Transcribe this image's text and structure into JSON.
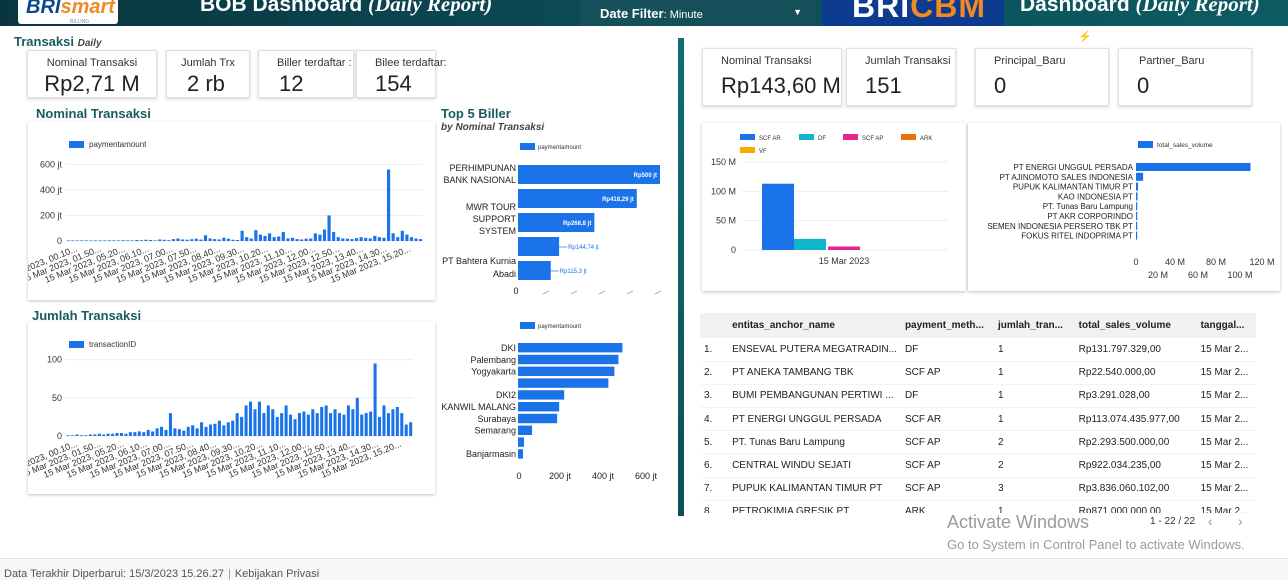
{
  "header": {
    "logo_main": "BRI",
    "logo_accent": "smart",
    "logo_sub": "BILLING",
    "title_left": "BOB Dashboard",
    "title_left_italic": "(Daily Report)",
    "date_filter_label": "Date Filter",
    "date_filter_value": ": Minute",
    "cbm_main": "BRI",
    "cbm_accent": "CBM",
    "title_right": "Dashboard",
    "title_right_italic": "(Daily Report)"
  },
  "transaksi": {
    "title": "Transaksi",
    "subtitle": "Daily",
    "cards": [
      {
        "label": "Nominal Transaksi",
        "value": "Rp2,71 M"
      },
      {
        "label": "Jumlah Trx",
        "value": "2 rb"
      },
      {
        "label": "Biller terdaftar :",
        "value": "12"
      },
      {
        "label": "Bilee terdaftar:",
        "value": "154"
      }
    ]
  },
  "right_cards": [
    {
      "label": "Nominal Transaksi",
      "value": "Rp143,60 M"
    },
    {
      "label": "Jumlah Transaksi",
      "value": "151"
    },
    {
      "label": "Principal_Baru",
      "value": "0"
    },
    {
      "label": "Partner_Baru",
      "value": "0"
    }
  ],
  "sections": {
    "nominal_title": "Nominal Transaksi",
    "jumlah_title": "Jumlah Transaksi",
    "top5_title": "Top 5 Biller",
    "top5_sub": "by  Nominal Transaksi"
  },
  "chart_data": [
    {
      "type": "bar",
      "name": "Nominal Transaksi",
      "legend": "paymentamount",
      "ylabel": "",
      "yticks": [
        "0",
        "200 jt",
        "400 jt",
        "600 jt"
      ],
      "ylim": [
        0,
        650
      ],
      "unit": "jt",
      "x_tick_labels": [
        "2023, 00.10...",
        "15 Mar 2023, 01.50...",
        "15 Mar 2023, 05.20...",
        "15 Mar 2023, 06.10...",
        "15 Mar 2023, 07.00...",
        "15 Mar 2023, 07.50...",
        "15 Mar 2023, 08.40...",
        "15 Mar 2023, 09.30...",
        "15 Mar 2023, 10.20...",
        "15 Mar 2023, 11.10...",
        "15 Mar 2023, 12.00...",
        "15 Mar 2023, 12.50...",
        "15 Mar 2023, 13.40...",
        "15 Mar 2023, 14.30...",
        "15 Mar 2023, 15.20..."
      ],
      "values": [
        2,
        1,
        2,
        3,
        1,
        2,
        4,
        3,
        2,
        5,
        4,
        3,
        6,
        5,
        4,
        8,
        6,
        10,
        8,
        5,
        12,
        9,
        7,
        15,
        20,
        12,
        10,
        14,
        18,
        11,
        45,
        20,
        15,
        12,
        25,
        18,
        10,
        8,
        80,
        30,
        20,
        85,
        50,
        40,
        60,
        30,
        35,
        70,
        20,
        25,
        15,
        12,
        18,
        20,
        60,
        50,
        90,
        200,
        70,
        30,
        20,
        18,
        15,
        22,
        30,
        25,
        20,
        40,
        30,
        25,
        560,
        60,
        30,
        80,
        50,
        30,
        20,
        15
      ]
    },
    {
      "type": "bar",
      "name": "Jumlah Transaksi",
      "legend": "transactionID",
      "yticks": [
        "0",
        "50",
        "100"
      ],
      "ylim": [
        0,
        110
      ],
      "x_tick_labels": [
        "2023, 00.10...",
        "15 Mar 2023, 01.50...",
        "15 Mar 2023, 05.20...",
        "15 Mar 2023, 06.10...",
        "15 Mar 2023, 07.00...",
        "15 Mar 2023, 07.50...",
        "15 Mar 2023, 08.40...",
        "15 Mar 2023, 09.30...",
        "15 Mar 2023, 10.20...",
        "15 Mar 2023, 11.10...",
        "15 Mar 2023, 12.00...",
        "15 Mar 2023, 12.50...",
        "15 Mar 2023, 13.40...",
        "15 Mar 2023, 14.30...",
        "15 Mar 2023, 15.20..."
      ],
      "values": [
        1,
        1,
        2,
        1,
        1,
        2,
        2,
        3,
        2,
        3,
        3,
        4,
        4,
        3,
        5,
        5,
        6,
        5,
        8,
        6,
        10,
        12,
        8,
        30,
        10,
        9,
        7,
        12,
        14,
        10,
        18,
        12,
        15,
        16,
        20,
        14,
        18,
        20,
        30,
        25,
        40,
        45,
        35,
        45,
        30,
        40,
        35,
        25,
        30,
        40,
        28,
        22,
        30,
        32,
        28,
        35,
        30,
        38,
        40,
        30,
        35,
        30,
        28,
        40,
        35,
        50,
        28,
        30,
        32,
        95,
        25,
        40,
        30,
        35,
        38,
        30,
        15,
        18
      ]
    },
    {
      "type": "bar",
      "orientation": "horizontal",
      "name": "Top 5 Biller",
      "legend": "paymentamount",
      "categories": [
        "PERHIMPUNAN BANK NASIONAL",
        "",
        "MWR TOUR SUPPORT SYSTEM",
        "",
        "PT Bahtera Kurnia Abadi"
      ],
      "category_lines": [
        [
          "PERHIMPUNAN",
          "BANK NASIONAL"
        ],
        [],
        [
          "MWR TOUR",
          "SUPPORT",
          "SYSTEM"
        ],
        [],
        [
          "PT Bahtera Kurnia",
          "Abadi"
        ]
      ],
      "values": [
        500,
        418.29,
        268.8,
        144.74,
        115.3
      ],
      "value_labels": [
        "Rp500 jt",
        "Rp418,29 jt",
        "Rp268,8 jt",
        "Rp144,74 jt",
        "Rp115,3 jt"
      ]
    },
    {
      "type": "bar",
      "orientation": "horizontal",
      "name": "Regional",
      "legend": "paymentamount",
      "categories": [
        "DKI",
        "Palembang",
        "Yogyakarta",
        "",
        "DKI2",
        "KANWIL MALANG",
        "Surabaya",
        "Semarang",
        "",
        "Banjarmasin"
      ],
      "values": [
        520,
        500,
        480,
        450,
        230,
        205,
        195,
        70,
        30,
        25
      ],
      "xticks": [
        "0",
        "200 jt",
        "400 jt",
        "600 jt"
      ],
      "xlim": [
        0,
        650
      ]
    },
    {
      "type": "bar",
      "name": "Daily by payment method",
      "legend": [
        "SCF AR",
        "DF",
        "SCF AP",
        "ARK",
        "VF"
      ],
      "legend_colors": [
        "#1a73e8",
        "#12b5cb",
        "#e52592",
        "#e8710a",
        "#f9ab00"
      ],
      "categories": [
        "15 Mar 2023"
      ],
      "values": [
        113,
        19,
        6,
        0,
        0
      ],
      "yticks": [
        "0",
        "50 M",
        "100 M",
        "150 M"
      ],
      "ylim": [
        0,
        150
      ]
    },
    {
      "type": "bar",
      "orientation": "horizontal",
      "name": "Sales volume",
      "legend": "total_sales_volume",
      "categories": [
        "PT ENERGI UNGGUL PERSADA",
        "PT AJINOMOTO SALES INDONESIA",
        "PUPUK KALIMANTAN TIMUR PT",
        "KAO INDONESIA PT",
        "PT. Tunas Baru Lampung",
        "PT AKR CORPORINDO",
        "SEMEN INDONESIA PERSERO TBK PT",
        "FOKUS RITEL INDOPRIMA PT"
      ],
      "values": [
        113,
        7,
        2,
        1.5,
        1.2,
        1,
        0.8,
        0.6
      ],
      "xticks_top": [
        "0",
        "40 M",
        "80 M",
        "120 M"
      ],
      "xticks_bottom": [
        "20 M",
        "60 M",
        "100 M"
      ],
      "xlim": [
        0,
        120
      ]
    },
    {
      "type": "table",
      "columns": [
        "entitas_anchor_name",
        "payment_meth...",
        "jumlah_tran...",
        "total_sales_volume",
        "tanggal..."
      ],
      "rows": [
        [
          "1.",
          "ENSEVAL PUTERA MEGATRADIN...",
          "DF",
          "1",
          "Rp131.797.329,00",
          "15 Mar 2..."
        ],
        [
          "2.",
          "PT ANEKA TAMBANG TBK",
          "SCF AP",
          "1",
          "Rp22.540.000,00",
          "15 Mar 2..."
        ],
        [
          "3.",
          "BUMI PEMBANGUNAN PERTIWI ...",
          "DF",
          "1",
          "Rp3.291.028,00",
          "15 Mar 2..."
        ],
        [
          "4.",
          "PT ENERGI UNGGUL PERSADA",
          "SCF AR",
          "1",
          "Rp113.074.435.977,00",
          "15 Mar 2..."
        ],
        [
          "5.",
          "PT. Tunas Baru Lampung",
          "SCF AP",
          "2",
          "Rp2.293.500.000,00",
          "15 Mar 2..."
        ],
        [
          "6.",
          "CENTRAL WINDU SEJATI",
          "SCF AP",
          "2",
          "Rp922.034.235,00",
          "15 Mar 2..."
        ],
        [
          "7.",
          "PUPUK KALIMANTAN TIMUR PT",
          "SCF AP",
          "3",
          "Rp3.836.060.102,00",
          "15 Mar 2..."
        ],
        [
          "8.",
          "PETROKIMIA GRESIK PT",
          "ARK",
          "1",
          "Rp871.000.000,00",
          "15 Mar 2..."
        ]
      ]
    }
  ],
  "table_pager": {
    "range": "1 - 22 / 22",
    "prev": "‹",
    "next": "›"
  },
  "windows_watermark": {
    "line1": "Activate Windows",
    "line2": "Go to System in Control Panel to activate Windows."
  },
  "footer": {
    "updated": "Data Terakhir Diperbarui: 15/3/2023 15.26.27",
    "privacy": "Kebijakan Privasi"
  },
  "colors": {
    "bar": "#1a73e8",
    "title": "#1a5b60",
    "header_bg": "#0b4a55"
  }
}
